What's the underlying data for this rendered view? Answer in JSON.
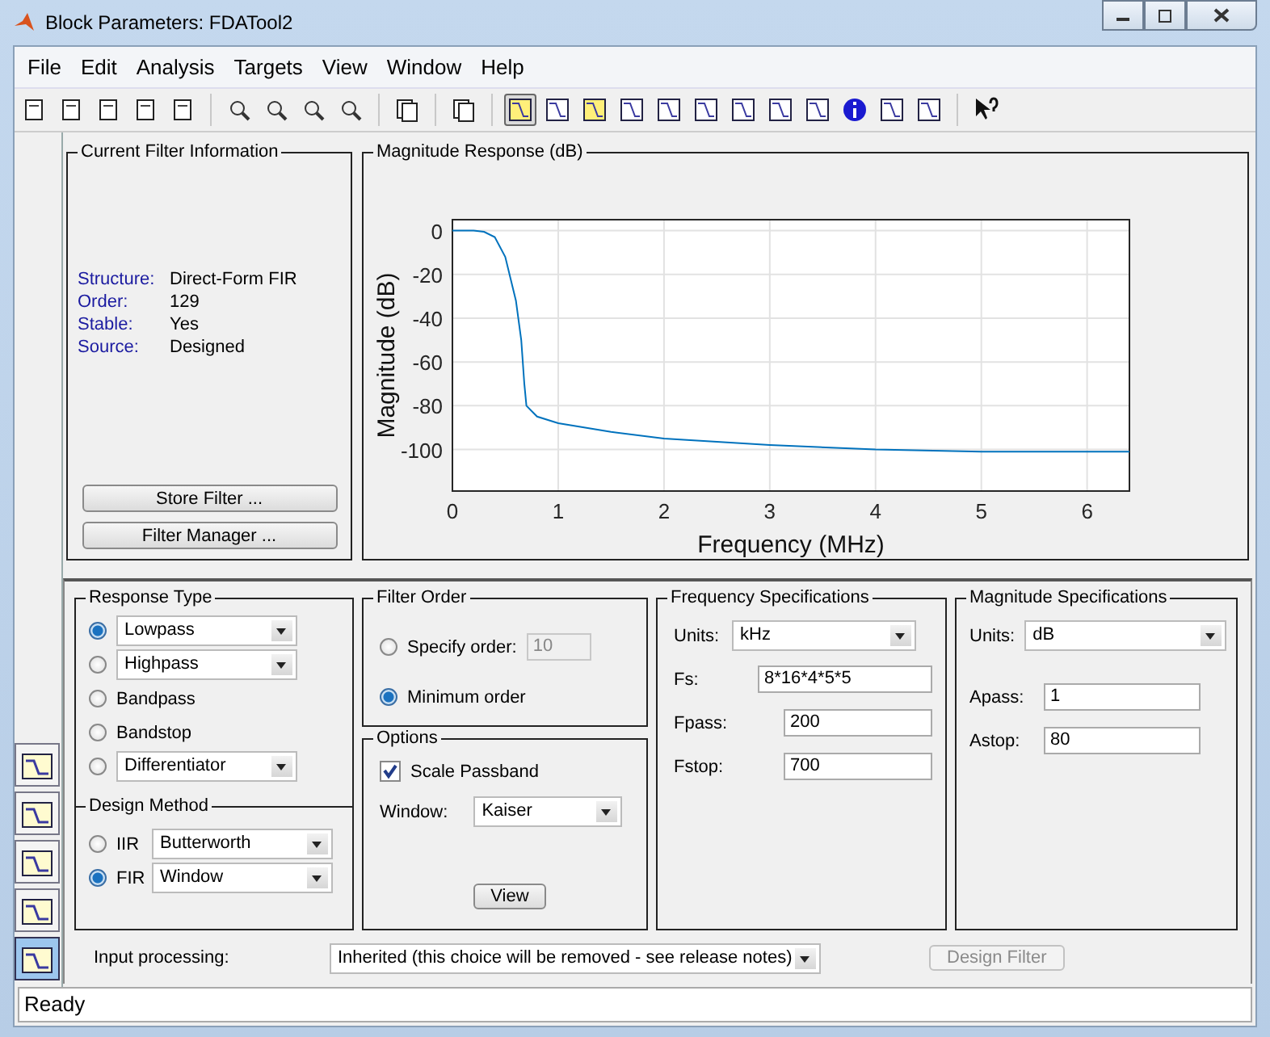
{
  "window": {
    "title": "Block Parameters: FDATool2"
  },
  "menu": [
    {
      "label": "File"
    },
    {
      "label": "Edit"
    },
    {
      "label": "Analysis"
    },
    {
      "label": "Targets"
    },
    {
      "label": "View"
    },
    {
      "label": "Window"
    },
    {
      "label": "Help"
    }
  ],
  "toolbar": [
    {
      "selected": false
    },
    {
      "selected": false
    },
    {
      "selected": false
    },
    {
      "selected": false
    },
    {
      "selected": false
    },
    {
      "selected": false
    },
    {
      "selected": false
    },
    {
      "selected": false
    },
    {
      "selected": false
    },
    {
      "selected": false
    },
    {
      "selected": false
    },
    {
      "selected": true
    },
    {
      "selected": false
    },
    {
      "selected": false
    },
    {
      "selected": false
    },
    {
      "selected": false
    },
    {
      "selected": false
    },
    {
      "selected": false
    },
    {
      "selected": false
    },
    {
      "selected": false
    },
    {
      "selected": false
    },
    {
      "selected": false
    },
    {
      "selected": false
    },
    {
      "selected": false
    }
  ],
  "filter_info": {
    "title": "Current Filter Information",
    "rows": [
      {
        "label": "Structure:",
        "value": "Direct-Form FIR"
      },
      {
        "label": "Order:",
        "value": "129"
      },
      {
        "label": "Stable:",
        "value": "Yes"
      },
      {
        "label": "Source:",
        "value": "Designed"
      }
    ],
    "buttons": [
      "Store Filter ...",
      "Filter Manager ..."
    ]
  },
  "magnitude_panel": {
    "title": "Magnitude Response (dB)",
    "chart_data": {
      "type": "line",
      "xlabel": "Frequency (MHz)",
      "ylabel": "Magnitude (dB)",
      "x": [
        0,
        0.2,
        0.3,
        0.4,
        0.5,
        0.6,
        0.65,
        0.68,
        0.7,
        0.8,
        1,
        1.5,
        2,
        3,
        4,
        5,
        6,
        6.4
      ],
      "grid": true,
      "series": [
        {
          "color": "#0072bd",
          "values": [
            0,
            0,
            -0.5,
            -3,
            -12,
            -32,
            -50,
            -70,
            -80,
            -85,
            -88,
            -92,
            -95,
            -98,
            -100,
            -101,
            -101,
            -101
          ]
        }
      ],
      "xlim": [
        0,
        6.4
      ],
      "ylim": [
        -119,
        5
      ],
      "xticks": [
        0,
        1,
        2,
        3,
        4,
        5,
        6
      ],
      "yticks": [
        0,
        -20,
        -40,
        -60,
        -80,
        -100
      ]
    }
  },
  "side_tools": [
    {
      "selected": false
    },
    {
      "selected": false
    },
    {
      "selected": false
    },
    {
      "selected": false
    },
    {
      "selected": true
    }
  ],
  "response_type": {
    "title": "Response Type",
    "options": [
      {
        "kind": "dropdown",
        "label": "Lowpass",
        "selected": true
      },
      {
        "kind": "dropdown",
        "label": "Highpass",
        "selected": false
      },
      {
        "kind": "plain",
        "label": "Bandpass",
        "selected": false
      },
      {
        "kind": "plain",
        "label": "Bandstop",
        "selected": false
      },
      {
        "kind": "dropdown",
        "label": "Differentiator",
        "selected": false
      }
    ]
  },
  "design_method": {
    "title": "Design Method",
    "options": [
      {
        "label": "IIR",
        "value": "Butterworth",
        "selected": false
      },
      {
        "label": "FIR",
        "value": "Window",
        "selected": true
      }
    ]
  },
  "filter_order": {
    "title": "Filter Order",
    "options": [
      {
        "kind": "input",
        "label": "Specify order:",
        "value": "10",
        "disabled": true,
        "selected": false
      },
      {
        "kind": "plain",
        "label": "Minimum order",
        "selected": true
      }
    ]
  },
  "options": {
    "title": "Options",
    "checkbox": {
      "label": "Scale Passband",
      "checked": true
    },
    "window_label": "Window:",
    "window_value": "Kaiser",
    "button": "View"
  },
  "frequency_specs": {
    "title": "Frequency Specifications",
    "units_label": "Units:",
    "units": "kHz",
    "fields": [
      {
        "label": "Fs:",
        "value": "8*16*4*5*5"
      },
      {
        "label": "Fpass:",
        "value": "200"
      },
      {
        "label": "Fstop:",
        "value": "700"
      }
    ]
  },
  "magnitude_specs": {
    "title": "Magnitude Specifications",
    "units_label": "Units:",
    "units": "dB",
    "fields": [
      {
        "label": "Apass:",
        "value": "1"
      },
      {
        "label": "Astop:",
        "value": "80"
      }
    ]
  },
  "input_processing": {
    "label": "Input processing:",
    "value": "Inherited (this choice will be removed - see release notes)"
  },
  "design_button": {
    "label": "Design Filter",
    "disabled": true
  },
  "status_bar": "Ready"
}
